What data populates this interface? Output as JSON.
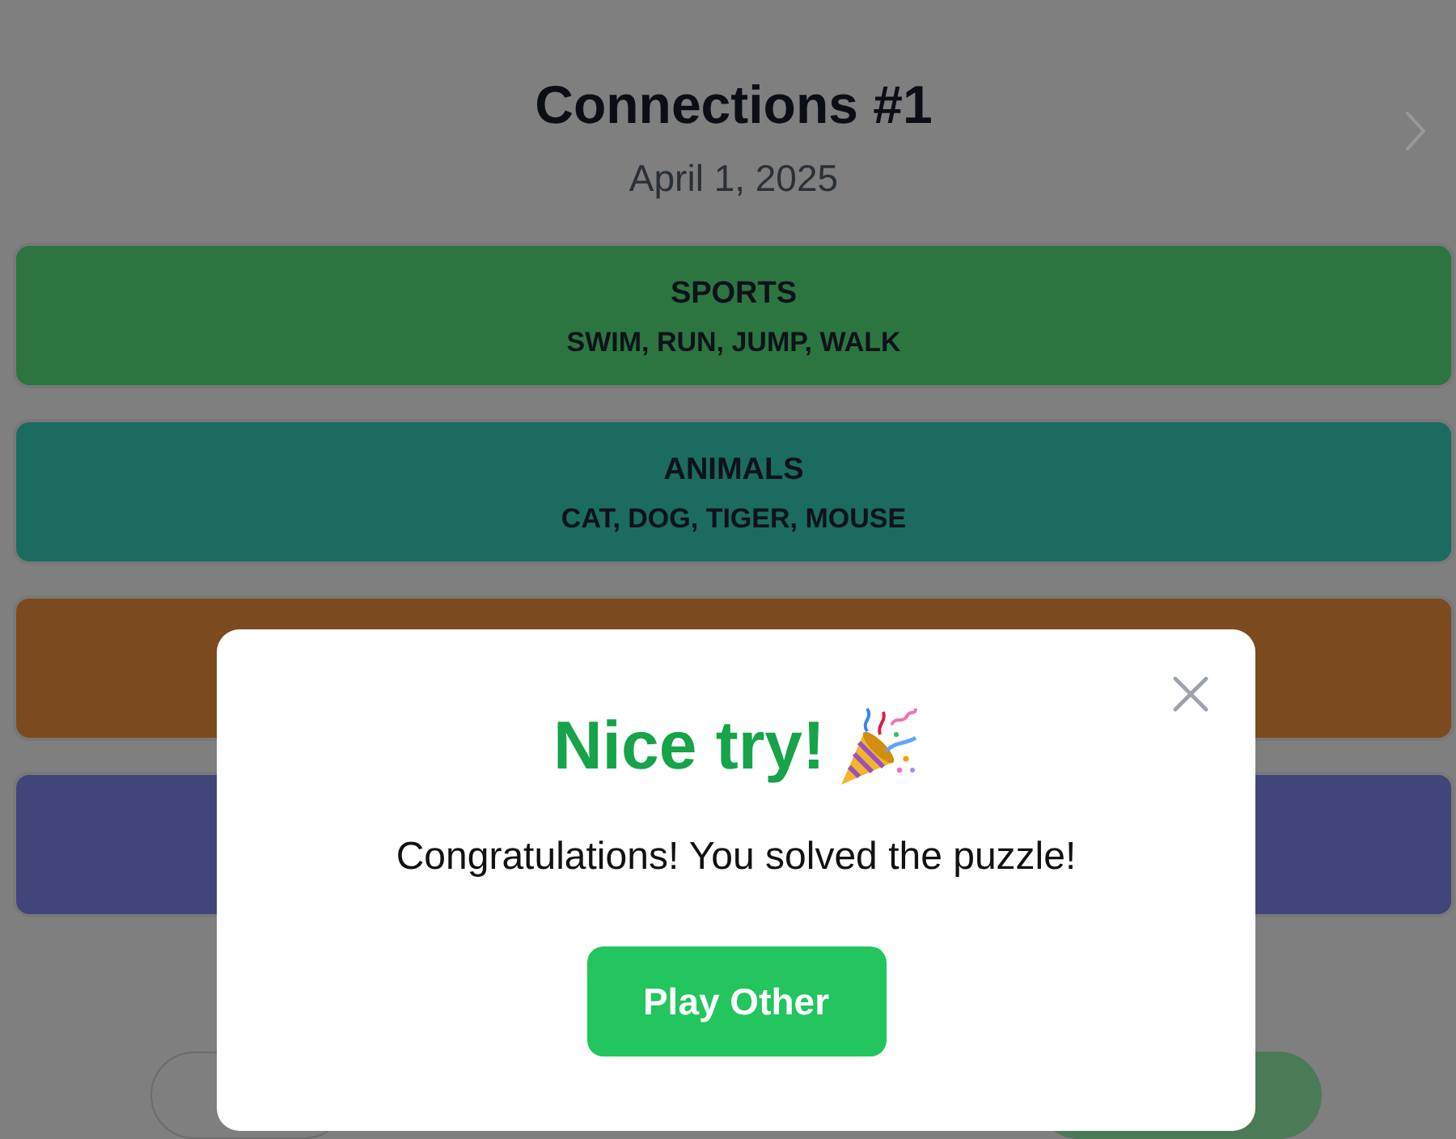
{
  "header": {
    "title": "Connections #1",
    "date": "April 1, 2025"
  },
  "groups": [
    {
      "title": "SPORTS",
      "words": "SWIM, RUN, JUMP, WALK",
      "color": "#2c7540"
    },
    {
      "title": "ANIMALS",
      "words": "CAT, DOG, TIGER, MOUSE",
      "color": "#1b6b60"
    },
    {
      "color": "#7b4a1e"
    },
    {
      "color": "#41457a"
    }
  ],
  "dialog": {
    "title": "Nice try!",
    "message": "Congratulations! You solved the puzzle!",
    "button": "Play Other"
  }
}
